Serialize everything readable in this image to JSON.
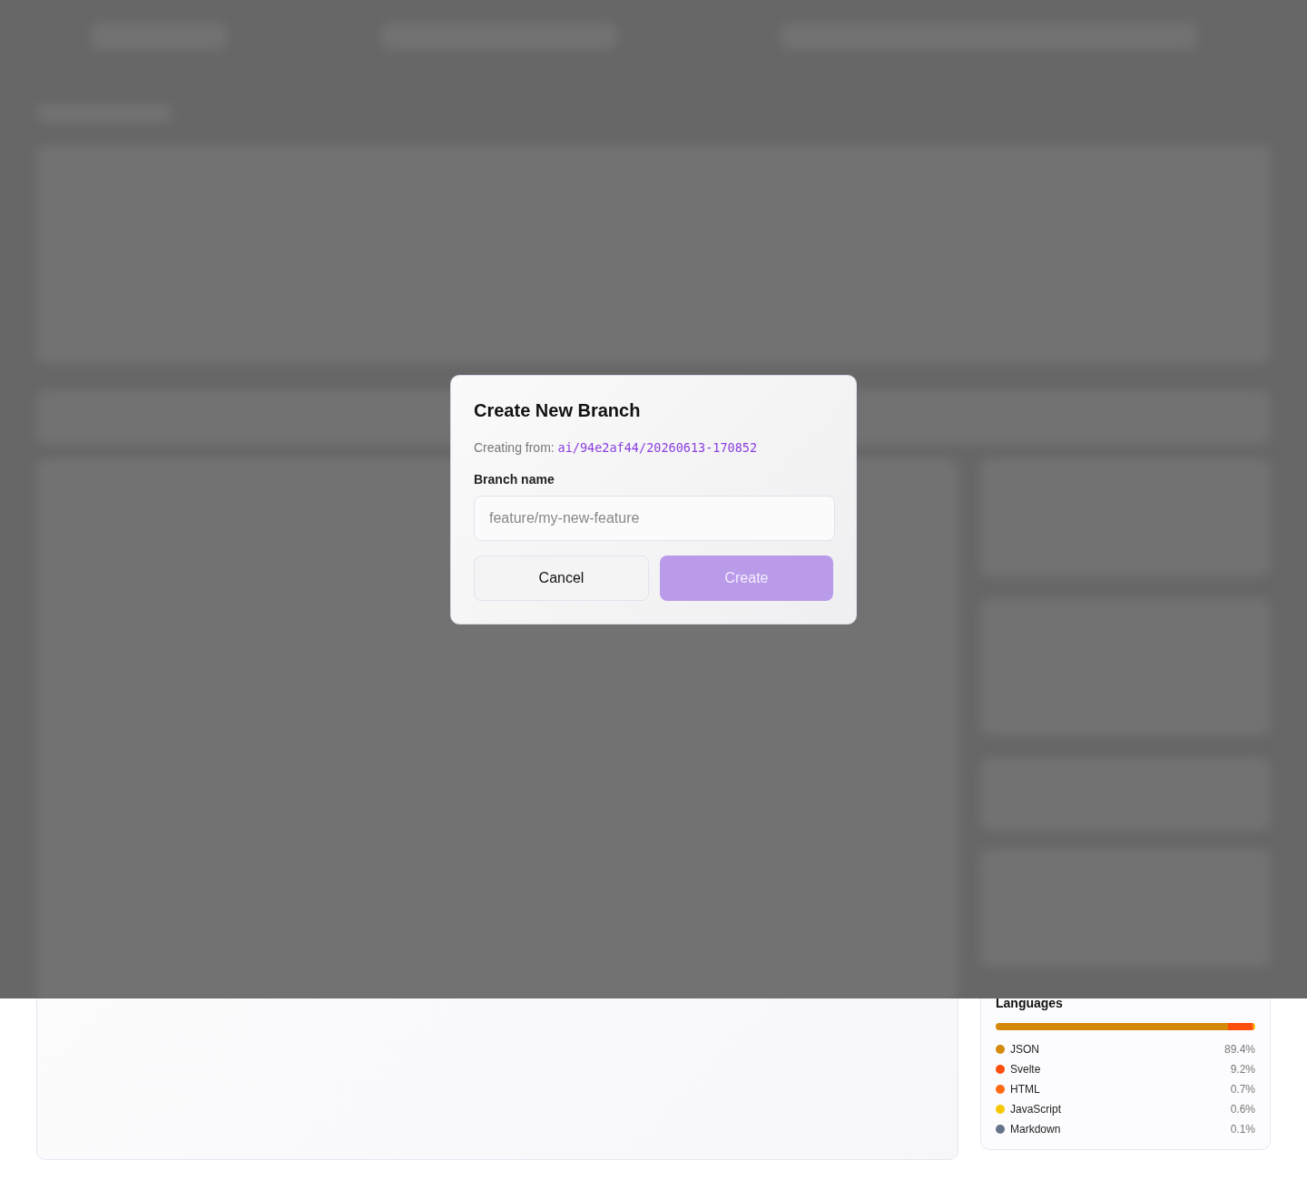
{
  "dialog": {
    "title": "Create New Branch",
    "source_label": "Creating from:",
    "source_branch": "ai/94e2af44/20260613-170852",
    "field_label": "Branch name",
    "field": {
      "placeholder": "feature/my-new-feature"
    },
    "buttons": [
      {
        "label": "Cancel",
        "kind": "secondary",
        "disabled": false
      },
      {
        "label": "Create",
        "kind": "primary",
        "disabled": true
      }
    ]
  },
  "languages": {
    "title": "Languages",
    "items": [
      {
        "name": "JSON",
        "percent": "89.4%",
        "level": 0.894,
        "color": "#d4890a"
      },
      {
        "name": "Svelte",
        "percent": "9.2%",
        "level": 0.092,
        "color": "#ff4d0a"
      },
      {
        "name": "HTML",
        "percent": "0.7%",
        "level": 0.007,
        "color": "#ff6a13"
      },
      {
        "name": "JavaScript",
        "percent": "0.6%",
        "level": 0.006,
        "color": "#f7c600"
      },
      {
        "name": "Markdown",
        "percent": "0.1%",
        "level": 0.001,
        "color": "#64748b"
      }
    ]
  }
}
